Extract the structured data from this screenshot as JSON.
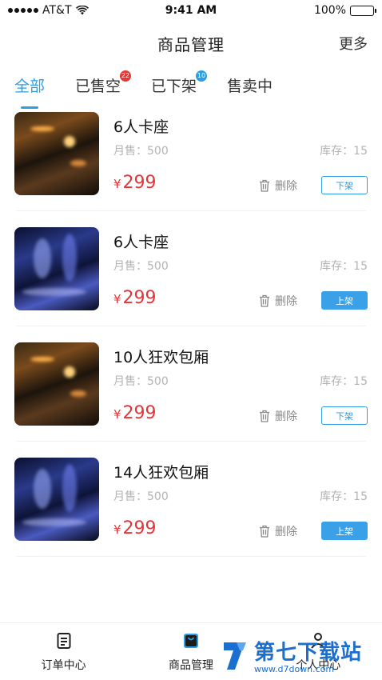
{
  "status": {
    "carrier": "AT&T",
    "time": "9:41 AM",
    "battery": "100%"
  },
  "nav": {
    "title": "商品管理",
    "more": "更多"
  },
  "tabs": [
    {
      "label": "全部",
      "active": true,
      "badge": ""
    },
    {
      "label": "已售空",
      "active": false,
      "badge": "22"
    },
    {
      "label": "已下架",
      "active": false,
      "badge": "10"
    },
    {
      "label": "售卖中",
      "active": false,
      "badge": ""
    }
  ],
  "products": [
    {
      "name": "6人卡座",
      "sales": "月售：500",
      "stock": "库存：15",
      "currency": "¥",
      "price": "299",
      "delete": "删除",
      "action": "下架",
      "image": "warm-bar-interior"
    },
    {
      "name": "6人卡座",
      "sales": "月售：500",
      "stock": "库存：15",
      "currency": "¥",
      "price": "299",
      "delete": "删除",
      "action": "上架",
      "image": "blue-bar-interior"
    },
    {
      "name": "10人狂欢包厢",
      "sales": "月售：500",
      "stock": "库存：15",
      "currency": "¥",
      "price": "299",
      "delete": "删除",
      "action": "下架",
      "image": "warm-bar-interior"
    },
    {
      "name": "14人狂欢包厢",
      "sales": "月售：500",
      "stock": "库存：15",
      "currency": "¥",
      "price": "299",
      "delete": "删除",
      "action": "上架",
      "image": "blue-bar-interior"
    }
  ],
  "tabbar": [
    {
      "label": "订单中心",
      "icon": "clipboard-icon"
    },
    {
      "label": "商品管理",
      "icon": "shopping-bag-icon"
    },
    {
      "label": "个人中心",
      "icon": "person-icon"
    }
  ],
  "watermark": {
    "main": "第七下载站",
    "url": "www.d7down.com"
  },
  "colors": {
    "accent": "#2d9ee0",
    "price": "#e8333a",
    "badge_red": "#e53935"
  }
}
